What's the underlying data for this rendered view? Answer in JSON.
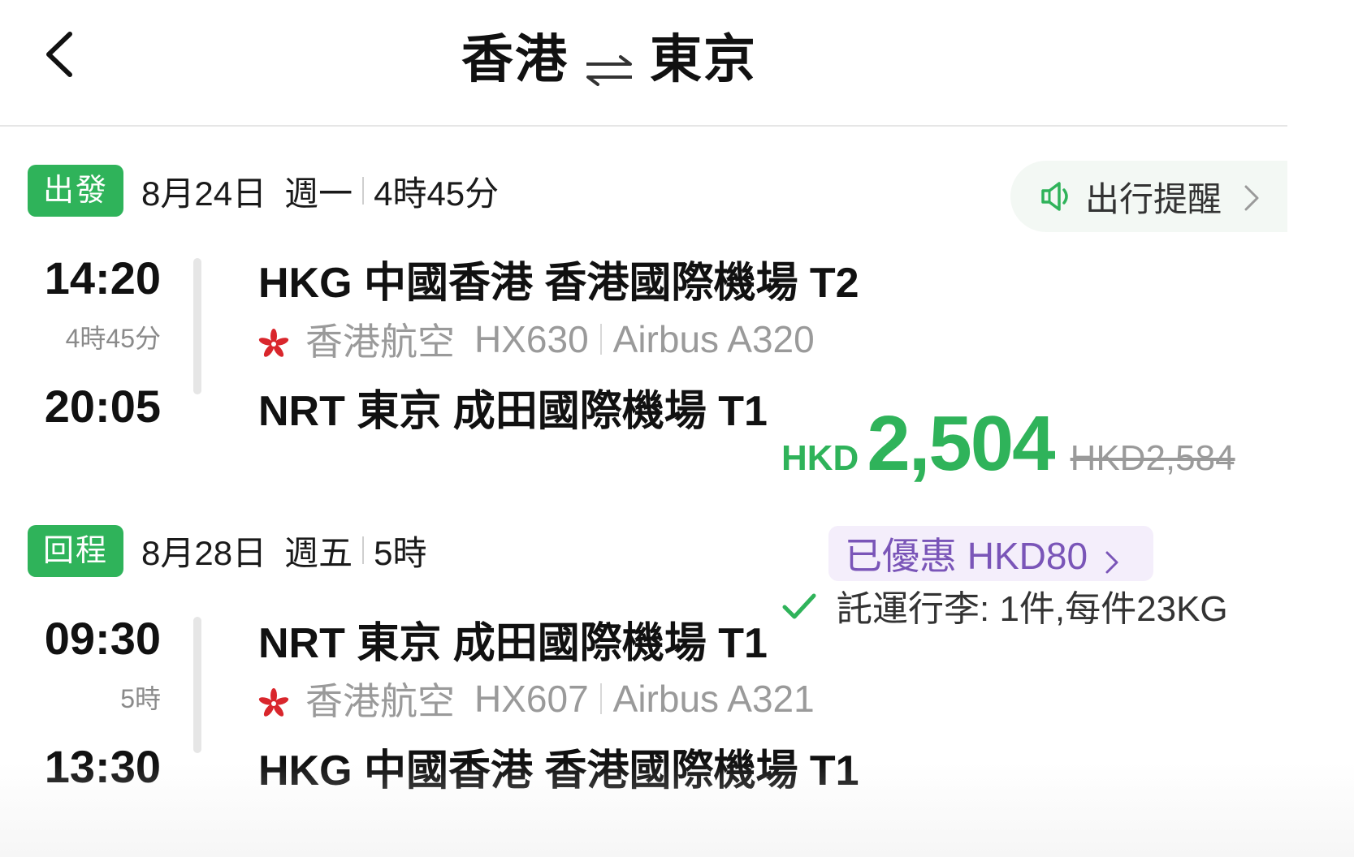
{
  "header": {
    "origin": "香港",
    "destination": "東京"
  },
  "outbound": {
    "badge": "出發",
    "date": "8月24日",
    "weekday": "週一",
    "duration": "4時45分",
    "depart_time": "14:20",
    "leg_duration": "4時45分",
    "arrive_time": "20:05",
    "depart_airport": "HKG 中國香港 香港國際機場 T2",
    "airline": "香港航空",
    "flight_no": "HX630",
    "aircraft": "Airbus A320",
    "arrive_airport": "NRT 東京 成田國際機場 T1"
  },
  "reminder": {
    "label": "出行提醒"
  },
  "price": {
    "currency": "HKD",
    "amount": "2,504",
    "original": "HKD2,584",
    "discount_label": "已優惠 HKD80",
    "baggage": "託運行李: 1件,每件23KG"
  },
  "return": {
    "badge": "回程",
    "date": "8月28日",
    "weekday": "週五",
    "duration": "5時",
    "depart_time": "09:30",
    "leg_duration": "5時",
    "arrive_time": "13:30",
    "depart_airport": "NRT 東京 成田國際機場 T1",
    "airline": "香港航空",
    "flight_no": "HX607",
    "aircraft": "Airbus A321",
    "arrive_airport": "HKG 中國香港 香港國際機場 T1"
  },
  "colors": {
    "accent_green": "#2fb35a",
    "discount_purple": "#7a55b8",
    "muted_gray": "#9a9a9a"
  },
  "icons": [
    "back-icon",
    "swap-icon",
    "speaker-icon",
    "chevron-right-icon",
    "airline-logo-icon",
    "check-icon"
  ]
}
